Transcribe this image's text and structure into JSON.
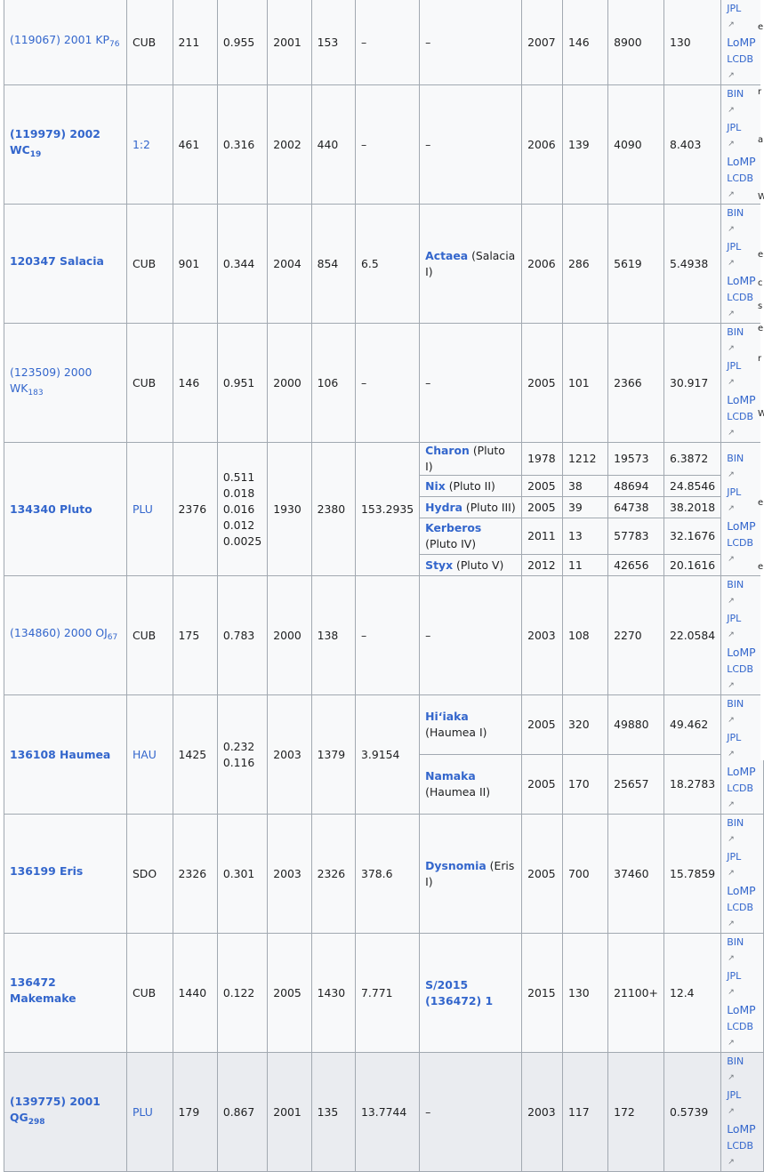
{
  "rows": [
    {
      "name_pre": "(119067) 2001 KP",
      "name_sub": "76",
      "bold": false,
      "cls": "CUB",
      "cls_link": false,
      "diam": "211",
      "alb": "0.955",
      "disc": "2001",
      "h": "153",
      "mass": "–",
      "moon": "–",
      "moon_rest": "",
      "myr": "2007",
      "mdiam": "146",
      "msma": "8900",
      "mper": "130",
      "links": [
        "JPL",
        "LoMP",
        "LCDB"
      ]
    },
    {
      "name_pre": "(119979) 2002 WC",
      "name_sub": "19",
      "bold": true,
      "cls": "1:2",
      "cls_link": true,
      "diam": "461",
      "alb": "0.316",
      "disc": "2002",
      "h": "440",
      "mass": "–",
      "moon": "–",
      "moon_rest": "",
      "myr": "2006",
      "mdiam": "139",
      "msma": "4090",
      "mper": "8.403",
      "links": [
        "BIN",
        "JPL",
        "LoMP",
        "LCDB"
      ]
    },
    {
      "name_pre": "120347 Salacia",
      "name_sub": "",
      "bold": true,
      "cls": "CUB",
      "cls_link": false,
      "diam": "901",
      "alb": "0.344",
      "disc": "2004",
      "h": "854",
      "mass": "6.5",
      "moon": "Actaea",
      "moon_rest": " (Salacia I)",
      "myr": "2006",
      "mdiam": "286",
      "msma": "5619",
      "mper": "5.4938",
      "links": [
        "BIN",
        "JPL",
        "LoMP",
        "LCDB"
      ]
    },
    {
      "name_pre": "(123509) 2000 WK",
      "name_sub": "183",
      "bold": false,
      "cls": "CUB",
      "cls_link": false,
      "diam": "146",
      "alb": "0.951",
      "disc": "2000",
      "h": "106",
      "mass": "–",
      "moon": "–",
      "moon_rest": "",
      "myr": "2005",
      "mdiam": "101",
      "msma": "2366",
      "mper": "30.917",
      "links": [
        "BIN",
        "JPL",
        "LoMP",
        "LCDB"
      ]
    }
  ],
  "pluto": {
    "name": "134340 Pluto",
    "cls": "PLU",
    "diam": "2376",
    "albs": [
      "0.511",
      "0.018",
      "0.016",
      "0.012",
      "0.0025"
    ],
    "disc": "1930",
    "h": "2380",
    "mass": "153.2935",
    "moons": [
      {
        "name": "Charon",
        "rest": " (Pluto I)",
        "yr": "1978",
        "d": "1212",
        "a": "19573",
        "p": "6.3872"
      },
      {
        "name": "Nix",
        "rest": " (Pluto II)",
        "yr": "2005",
        "d": "38",
        "a": "48694",
        "p": "24.8546"
      },
      {
        "name": "Hydra",
        "rest": " (Pluto III)",
        "yr": "2005",
        "d": "39",
        "a": "64738",
        "p": "38.2018"
      },
      {
        "name": "Kerberos",
        "rest": " (Pluto IV)",
        "yr": "2011",
        "d": "13",
        "a": "57783",
        "p": "32.1676"
      },
      {
        "name": "Styx",
        "rest": " (Pluto V)",
        "yr": "2012",
        "d": "11",
        "a": "42656",
        "p": "20.1616"
      }
    ],
    "links": [
      "BIN",
      "JPL",
      "LoMP",
      "LCDB"
    ]
  },
  "oj": {
    "name_pre": "(134860) 2000 OJ",
    "name_sub": "67",
    "cls": "CUB",
    "diam": "175",
    "alb": "0.783",
    "disc": "2000",
    "h": "138",
    "mass": "–",
    "moon": "–",
    "myr": "2003",
    "mdiam": "108",
    "msma": "2270",
    "mper": "22.0584",
    "links": [
      "BIN",
      "JPL",
      "LoMP",
      "LCDB"
    ]
  },
  "haumea": {
    "name": "136108 Haumea",
    "cls": "HAU",
    "diam": "1425",
    "albs": [
      "0.232",
      "0.116"
    ],
    "disc": "2003",
    "h": "1379",
    "mass": "3.9154",
    "moons": [
      {
        "name": "Hiʻiaka",
        "rest": " (Haumea I)",
        "yr": "2005",
        "d": "320",
        "a": "49880",
        "p": "49.462"
      },
      {
        "name": "Namaka",
        "rest": " (Haumea II)",
        "yr": "2005",
        "d": "170",
        "a": "25657",
        "p": "18.2783"
      }
    ],
    "links": [
      "BIN",
      "JPL",
      "LoMP",
      "LCDB"
    ]
  },
  "tail": [
    {
      "name_pre": "136199 Eris",
      "name_sub": "",
      "cls": "SDO",
      "cls_link": false,
      "diam": "2326",
      "alb": "0.301",
      "disc": "2003",
      "h": "2326",
      "mass": "378.6",
      "moon": "Dysnomia",
      "moon_rest": " (Eris I)",
      "myr": "2005",
      "mdiam": "700",
      "msma": "37460",
      "mper": "15.7859",
      "links": [
        "BIN",
        "JPL",
        "LoMP",
        "LCDB"
      ]
    },
    {
      "name_pre": "136472 Makemake",
      "name_sub": "",
      "cls": "CUB",
      "cls_link": false,
      "diam": "1440",
      "alb": "0.122",
      "disc": "2005",
      "h": "1430",
      "mass": "7.771",
      "moon": "S/2015 (136472) 1",
      "moon_rest": "",
      "myr": "2015",
      "mdiam": "130",
      "msma": "21100+",
      "mper": "12.4",
      "links": [
        "BIN",
        "JPL",
        "LoMP",
        "LCDB"
      ]
    },
    {
      "name_pre": "(139775) 2001 QG",
      "name_sub": "298",
      "cls": "PLU",
      "cls_link": true,
      "diam": "179",
      "alb": "0.867",
      "disc": "2001",
      "h": "135",
      "mass": "13.7744",
      "moon": "–",
      "moon_rest": "",
      "myr": "2003",
      "mdiam": "117",
      "msma": "172",
      "mper": "0.5739",
      "links": [
        "BIN",
        "JPL",
        "LoMP",
        "LCDB"
      ]
    }
  ],
  "stray_letters": [
    "e",
    "r",
    "a",
    "W",
    "e",
    "c",
    "s",
    "e",
    "r",
    "W",
    "e",
    "e"
  ],
  "ext_icon": "external-link-icon"
}
